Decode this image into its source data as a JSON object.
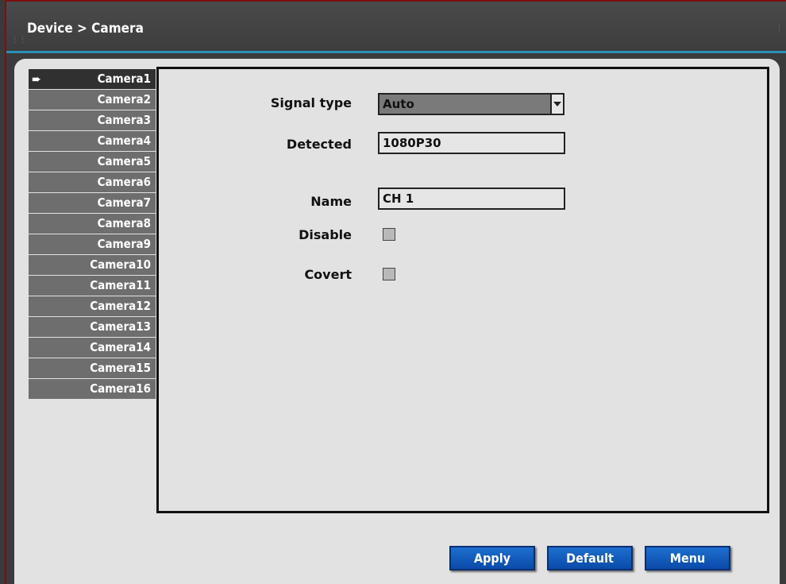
{
  "breadcrumb": "Device > Camera",
  "sidebar": {
    "cameras": [
      "Camera1",
      "Camera2",
      "Camera3",
      "Camera4",
      "Camera5",
      "Camera6",
      "Camera7",
      "Camera8",
      "Camera9",
      "Camera10",
      "Camera11",
      "Camera12",
      "Camera13",
      "Camera14",
      "Camera15",
      "Camera16"
    ],
    "selected_index": 0,
    "selected_icon": "arrow-right-icon"
  },
  "form": {
    "signal_type": {
      "label": "Signal type",
      "value": "Auto"
    },
    "detected": {
      "label": "Detected",
      "value": "1080P30"
    },
    "name": {
      "label": "Name",
      "value": "CH 1"
    },
    "disable": {
      "label": "Disable",
      "checked": false
    },
    "covert": {
      "label": "Covert",
      "checked": false
    }
  },
  "buttons": {
    "apply": "Apply",
    "default": "Default",
    "menu": "Menu"
  },
  "colors": {
    "accent_line": "#2a8fb8",
    "button_blue": "#0b4aa8",
    "item_gray": "#6e6e6e",
    "item_selected": "#303030"
  }
}
